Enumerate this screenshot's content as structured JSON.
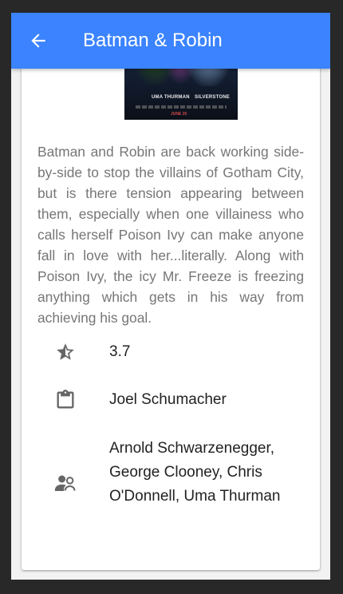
{
  "app_bar": {
    "title": "Batman & Robin",
    "back_icon": "arrow-back-icon",
    "color": "#3b83ff"
  },
  "movie": {
    "poster": {
      "alt": "Batman & Robin poster",
      "credit_left": "UMA THURMAN",
      "credit_right": "SILVERSTONE",
      "date": "JUNE 20"
    },
    "description": "Batman and Robin are back working side-by-side to stop the villains of Gotham City, but is there tension appearing between them, especially when one villainess who calls herself Poison Ivy can make anyone fall in love with her...literally. Along with Poison Ivy, the icy Mr. Freeze is freezing anything which gets in his way from achieving his goal.",
    "details": [
      {
        "icon": "star-half-icon",
        "value": "3.7"
      },
      {
        "icon": "clipboard-icon",
        "value": "Joel Schumacher"
      },
      {
        "icon": "people-icon",
        "value": "Arnold Schwarzenegger, George Clooney, Chris O'Donnell, Uma Thurman"
      }
    ]
  },
  "colors": {
    "accent": "#3b83ff",
    "icon": "#666666",
    "description_text": "#767676"
  }
}
